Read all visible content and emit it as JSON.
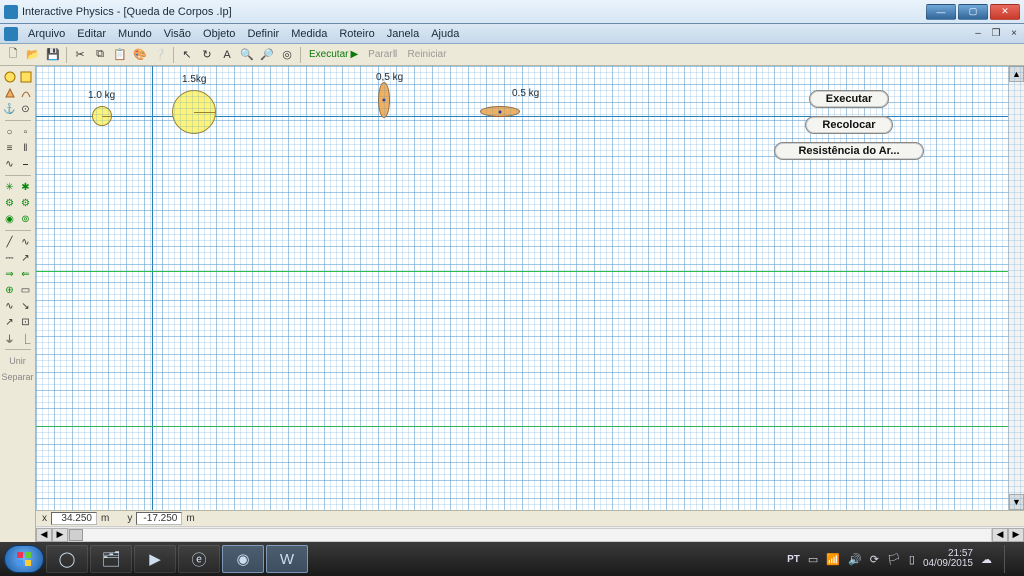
{
  "window": {
    "title": "Interactive Physics - [Queda de Corpos .Ip]"
  },
  "menu": {
    "items": [
      "Arquivo",
      "Editar",
      "Mundo",
      "Visão",
      "Objeto",
      "Definir",
      "Medida",
      "Roteiro",
      "Janela",
      "Ajuda"
    ]
  },
  "toolbar": {
    "run": "Executar",
    "stop": "Parar",
    "reset": "Reiniciar"
  },
  "simbuttons": {
    "run": "Executar",
    "reset": "Recolocar",
    "air": "Resistência do Ar..."
  },
  "objects": {
    "ball1": "1.0 kg",
    "ball2": "1.5kg",
    "ell1": "0,5 kg",
    "ell2": "0.5 kg"
  },
  "sidebar": {
    "link": "Unir",
    "separate": "Separar"
  },
  "coords": {
    "xlabel": "x",
    "x": "34.250",
    "xunit": "m",
    "ylabel": "y",
    "y": "-17.250",
    "yunit": "m"
  },
  "tray": {
    "lang": "PT",
    "time": "21:57",
    "date": "04/09/2015"
  }
}
